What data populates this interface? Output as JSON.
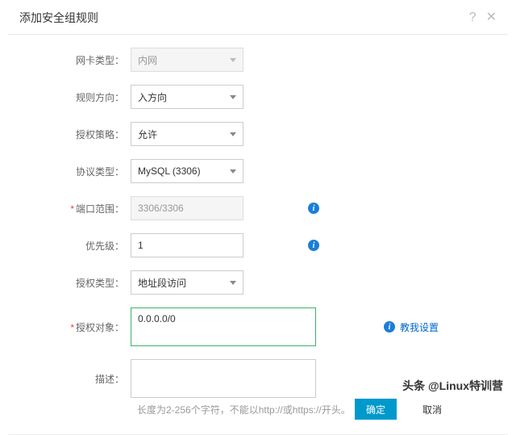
{
  "dialog": {
    "title": "添加安全组规则"
  },
  "form": {
    "nic_type": {
      "label": "网卡类型：",
      "value": "内网"
    },
    "direction": {
      "label": "规则方向：",
      "value": "入方向"
    },
    "policy": {
      "label": "授权策略：",
      "value": "允许"
    },
    "protocol": {
      "label": "协议类型：",
      "value": "MySQL (3306)"
    },
    "port_range": {
      "label": "端口范围：",
      "value": "3306/3306",
      "required": true
    },
    "priority": {
      "label": "优先级：",
      "value": "1"
    },
    "auth_type": {
      "label": "授权类型：",
      "value": "地址段访问"
    },
    "auth_object": {
      "label": "授权对象：",
      "value": "0.0.0.0/0",
      "required": true,
      "helper": "教我设置"
    },
    "description": {
      "label": "描述：",
      "value": "",
      "hint": "长度为2-256个字符，不能以http://或https://开头。"
    }
  },
  "footer": {
    "watermark": "头条 @Linux特训营",
    "ok": "确定",
    "cancel": "取消"
  },
  "icons": {
    "info": "i"
  }
}
